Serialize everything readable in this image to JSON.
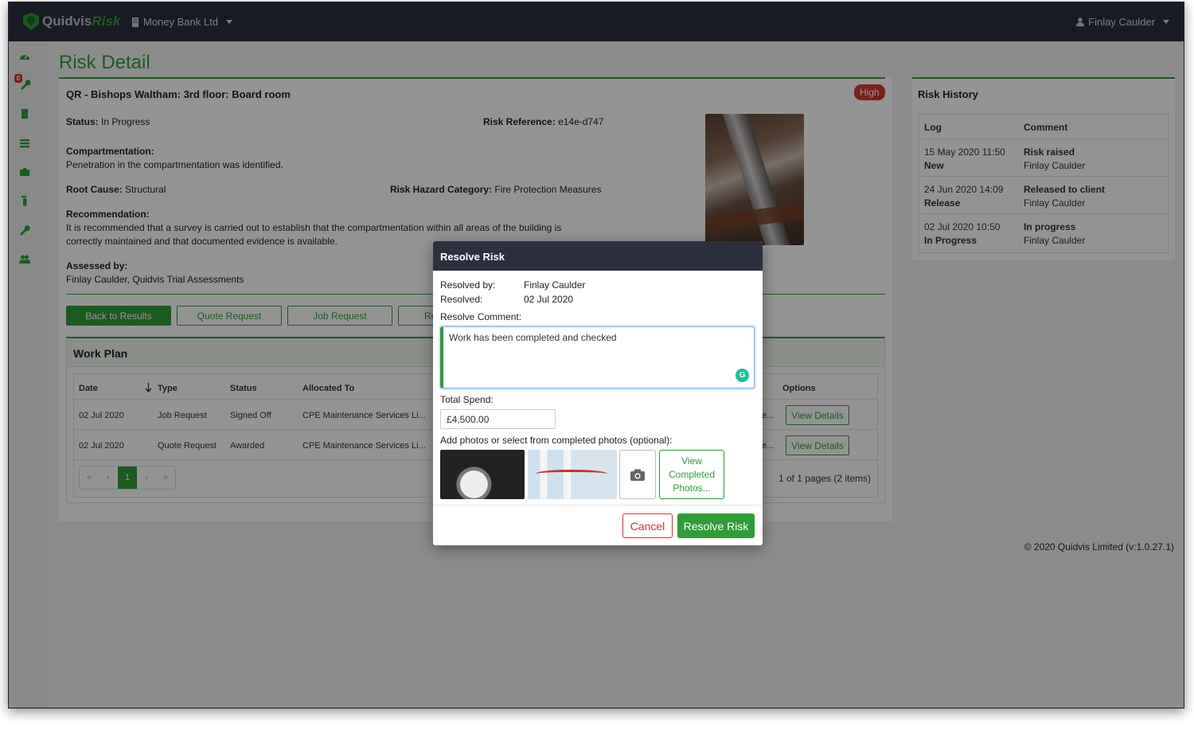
{
  "navbar": {
    "logo_a": "Quidvis",
    "logo_b": "Risk",
    "organisation": "Money Bank Ltd",
    "user": "Finlay Caulder"
  },
  "sidebar": {
    "badge": "0",
    "icons": [
      "dashboard-icon",
      "wrench-alert-icon",
      "building-icon",
      "list-icon",
      "briefcase-icon",
      "extinguisher-icon",
      "wrench-icon",
      "users-icon"
    ]
  },
  "page": {
    "title": "Risk Detail"
  },
  "risk": {
    "title": "QR - Bishops Waltham: 3rd floor: Board room",
    "severity": "High",
    "status_label": "Status:",
    "status_value": "In Progress",
    "reference_label": "Risk Reference:",
    "reference_value": "e14e-d747",
    "compartmentation_label": "Compartmentation:",
    "compartmentation_value": "Penetration in the compartmentation was identified.",
    "root_cause_label": "Root Cause:",
    "root_cause_value": "Structural",
    "hazard_label": "Risk Hazard Category:",
    "hazard_value": "Fire Protection Measures",
    "recommendation_label": "Recommendation:",
    "recommendation_line1": "It is recommended that a survey is carried out to establish that the compartmentation within all areas of the building is",
    "recommendation_line2": "correctly maintained and that documented evidence is available.",
    "assessed_label": "Assessed by:",
    "assessed_value": "Finlay Caulder, Quidvis Trial Assessments"
  },
  "actions": {
    "back": "Back to Results",
    "quote": "Quote Request",
    "job": "Job Request",
    "resolve_partial": "Re"
  },
  "work_plan": {
    "title": "Work Plan",
    "columns": {
      "date": "Date",
      "type": "Type",
      "status": "Status",
      "allocated": "Allocated To",
      "options": "Options"
    },
    "rows": [
      {
        "date": "02 Jul 2020",
        "type": "Job Request",
        "status": "Signed Off",
        "allocated": "CPE Maintenance Services Li...",
        "trail": "e...",
        "action": "View Details"
      },
      {
        "date": "02 Jul 2020",
        "type": "Quote Request",
        "status": "Awarded",
        "allocated": "CPE Maintenance Services Li...",
        "trail": "e...",
        "action": "View Details"
      }
    ],
    "pager": {
      "first": "«",
      "prev": "‹",
      "current": "1",
      "next": "›",
      "last": "»"
    },
    "page_info": "1 of 1 pages (2 items)"
  },
  "history": {
    "title": "Risk History",
    "columns": {
      "log": "Log",
      "comment": "Comment"
    },
    "rows": [
      {
        "date": "15 May 2020 11:50",
        "state": "New",
        "event": "Risk raised",
        "by": "Finlay Caulder"
      },
      {
        "date": "24 Jun 2020 14:09",
        "state": "Release",
        "event": "Released to client",
        "by": "Finlay Caulder"
      },
      {
        "date": "02 Jul 2020 10:50",
        "state": "In Progress",
        "event": "In progress",
        "by": "Finlay Caulder"
      }
    ]
  },
  "footer": "© 2020 Quidvis Limited (v:1.0.27.1)",
  "modal": {
    "title": "Resolve Risk",
    "resolved_by_label": "Resolved by:",
    "resolved_by_value": "Finlay Caulder",
    "resolved_label": "Resolved:",
    "resolved_value": "02 Jul 2020",
    "comment_label": "Resolve Comment:",
    "comment_value": "Work has been completed and checked",
    "spend_label": "Total Spend:",
    "spend_value": "£4,500.00",
    "photos_label": "Add photos or select from completed photos (optional):",
    "view_line1": "View",
    "view_line2": "Completed",
    "view_line3": "Photos...",
    "cancel": "Cancel",
    "resolve": "Resolve Risk"
  },
  "colors": {
    "brand_green": "#2e9d36",
    "navbar": "#2c2f3e",
    "danger": "#d9342b"
  }
}
